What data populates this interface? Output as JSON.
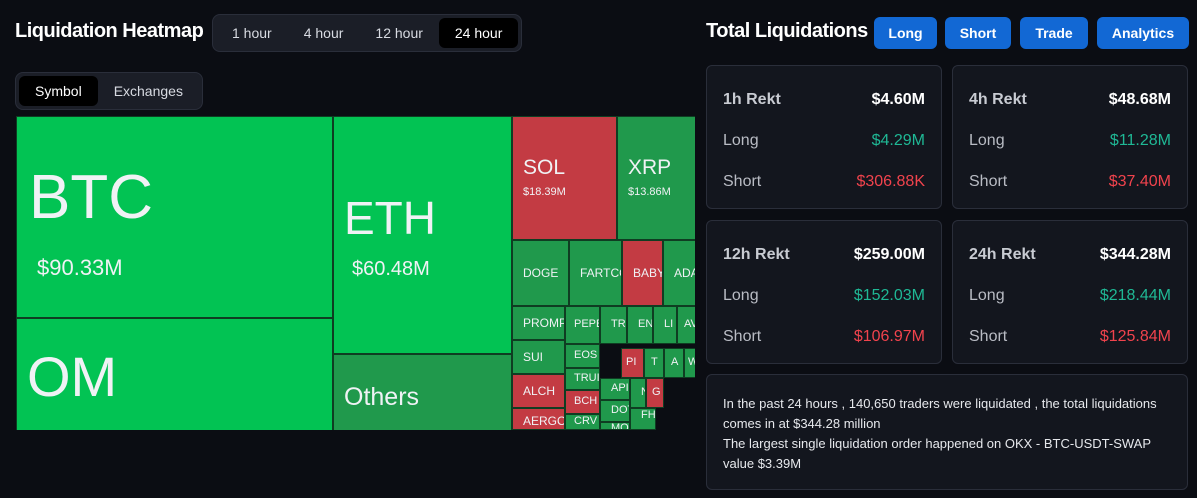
{
  "heatmap": {
    "title": "Liquidation Heatmap",
    "timeframes": [
      "1 hour",
      "4 hour",
      "12 hour",
      "24 hour"
    ],
    "active_timeframe": "24 hour",
    "groupby": [
      "Symbol",
      "Exchanges"
    ],
    "active_groupby": "Symbol",
    "cells": [
      {
        "symbol": "BTC",
        "value": "$90.33M",
        "side": "long"
      },
      {
        "symbol": "OM",
        "value": "",
        "side": "long"
      },
      {
        "symbol": "ETH",
        "value": "$60.48M",
        "side": "long"
      },
      {
        "symbol": "Others",
        "value": "",
        "side": "long"
      },
      {
        "symbol": "SOL",
        "value": "$18.39M",
        "side": "short"
      },
      {
        "symbol": "XRP",
        "value": "$13.86M",
        "side": "long"
      },
      {
        "symbol": "DOGE",
        "value": "",
        "side": "long"
      },
      {
        "symbol": "FARTCO",
        "value": "",
        "side": "long"
      },
      {
        "symbol": "BABY",
        "value": "",
        "side": "short"
      },
      {
        "symbol": "ADA",
        "value": "",
        "side": "long"
      },
      {
        "symbol": "PROMPT",
        "value": "",
        "side": "long"
      },
      {
        "symbol": "SUI",
        "value": "",
        "side": "long"
      },
      {
        "symbol": "ALCH",
        "value": "",
        "side": "short"
      },
      {
        "symbol": "AERGO",
        "value": "",
        "side": "short"
      },
      {
        "symbol": "PEPE",
        "value": "",
        "side": "long"
      },
      {
        "symbol": "TR",
        "value": "",
        "side": "long"
      },
      {
        "symbol": "EN",
        "value": "",
        "side": "long"
      },
      {
        "symbol": "LI",
        "value": "",
        "side": "long"
      },
      {
        "symbol": "AV",
        "value": "",
        "side": "long"
      },
      {
        "symbol": "EOS",
        "value": "",
        "side": "long"
      },
      {
        "symbol": "TRUI",
        "value": "",
        "side": "long"
      },
      {
        "symbol": "BCH",
        "value": "",
        "side": "short"
      },
      {
        "symbol": "CRV",
        "value": "",
        "side": "long"
      },
      {
        "symbol": "PI",
        "value": "",
        "side": "short"
      },
      {
        "symbol": "T",
        "value": "",
        "side": "long"
      },
      {
        "symbol": "A",
        "value": "",
        "side": "long"
      },
      {
        "symbol": "W",
        "value": "",
        "side": "long"
      },
      {
        "symbol": "API",
        "value": "",
        "side": "long"
      },
      {
        "symbol": "DOT",
        "value": "",
        "side": "long"
      },
      {
        "symbol": "MO",
        "value": "",
        "side": "long"
      },
      {
        "symbol": "N",
        "value": "",
        "side": "long"
      },
      {
        "symbol": "G",
        "value": "",
        "side": "short"
      },
      {
        "symbol": "FH",
        "value": "",
        "side": "long"
      }
    ]
  },
  "totals": {
    "title": "Total Liquidations",
    "buttons": [
      "Long",
      "Short",
      "Trade",
      "Analytics"
    ],
    "long_label": "Long",
    "short_label": "Short",
    "cards": [
      {
        "label": "1h Rekt",
        "total": "$4.60M",
        "long": "$4.29M",
        "short": "$306.88K"
      },
      {
        "label": "4h Rekt",
        "total": "$48.68M",
        "long": "$11.28M",
        "short": "$37.40M"
      },
      {
        "label": "12h Rekt",
        "total": "$259.00M",
        "long": "$152.03M",
        "short": "$106.97M"
      },
      {
        "label": "24h Rekt",
        "total": "$344.28M",
        "long": "$218.44M",
        "short": "$125.84M"
      }
    ]
  },
  "summary": {
    "line1": "In the past 24 hours , 140,650 traders were liquidated , the total liquidations comes in at $344.28 million",
    "line2": "The largest single liquidation order happened on OKX - BTC-USDT-SWAP value $3.39M"
  },
  "colors": {
    "bright_green": "#02c353",
    "green": "#20994c",
    "red": "#c33b43",
    "accent_blue": "#1268d4",
    "long_text": "#1fb895",
    "short_text": "#f1434d"
  }
}
